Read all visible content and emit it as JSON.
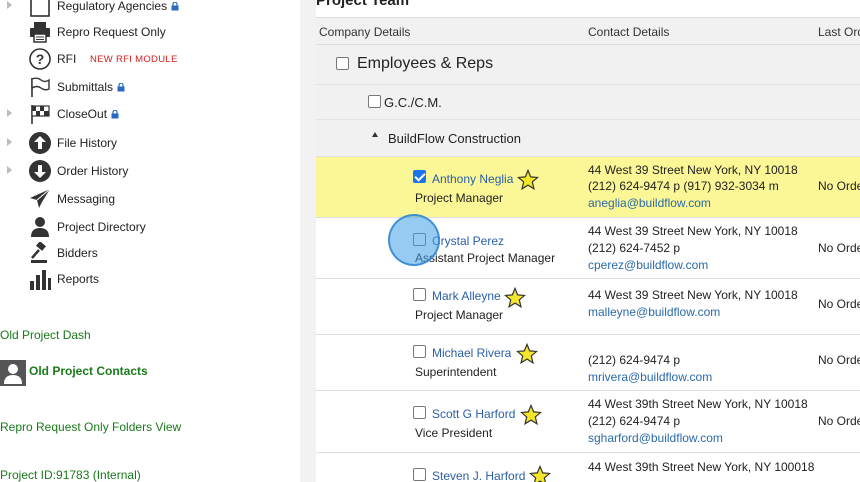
{
  "sidebar": {
    "items": [
      {
        "label": "Regulatory Agencies",
        "locked": true,
        "icon": "blank-doc-icon"
      },
      {
        "label": "Repro Request Only",
        "locked": false,
        "icon": "printer-icon"
      },
      {
        "label": "RFI",
        "locked": false,
        "icon": "question-icon",
        "badge": "NEW RFI MODULE"
      },
      {
        "label": "Submittals",
        "locked": true,
        "icon": "flag-icon"
      },
      {
        "label": "CloseOut",
        "locked": true,
        "icon": "checkered-flag-icon"
      },
      {
        "label": "File History",
        "locked": false,
        "icon": "arrow-up-circle-icon"
      },
      {
        "label": "Order History",
        "locked": false,
        "icon": "arrow-down-circle-icon"
      },
      {
        "label": "Messaging",
        "locked": false,
        "icon": "paper-plane-icon"
      },
      {
        "label": "Project Directory",
        "locked": false,
        "icon": "person-icon"
      },
      {
        "label": "Bidders",
        "locked": false,
        "icon": "gavel-icon"
      },
      {
        "label": "Reports",
        "locked": false,
        "icon": "bar-chart-icon"
      }
    ],
    "old_project_dash": "Old Project Dash",
    "old_project_contacts": "Old Project Contacts",
    "repro_folders_view": "Repro Request Only Folders View",
    "project_id": "Project ID:91783 (Internal)"
  },
  "main": {
    "title": "Project Team",
    "columns": {
      "company": "Company Details",
      "contact": "Contact Details",
      "last_order": "Last Ord"
    },
    "group_employees": "Employees & Reps",
    "group_gc": "G.C./C.M.",
    "company": "BuildFlow Construction",
    "contacts": [
      {
        "name": "Anthony Neglia",
        "role": "Project Manager",
        "starred": true,
        "checked": true,
        "address": "44 West 39 Street New York, NY 10018",
        "phone": "(212) 624-9474 p  (917) 932-3034 m",
        "email": "aneglia@buildflow.com",
        "last_order": "No Orde"
      },
      {
        "name": "Crystal Perez",
        "role": "Assistant Project Manager",
        "starred": false,
        "checked": false,
        "address": "44 West 39 Street New York, NY 10018",
        "phone": "(212) 624-7452 p",
        "email": "cperez@buildflow.com",
        "last_order": "No Orde"
      },
      {
        "name": "Mark Alleyne",
        "role": "Project Manager",
        "starred": true,
        "checked": false,
        "address": "44 West 39 Street New York, NY 10018",
        "phone": "",
        "email": "malleyne@buildflow.com",
        "last_order": "No Orde"
      },
      {
        "name": "Michael Rivera",
        "role": "Superintendent",
        "starred": true,
        "checked": false,
        "address": "",
        "phone": "(212) 624-9474 p",
        "email": "mrivera@buildflow.com",
        "last_order": "No Orde"
      },
      {
        "name": "Scott G Harford",
        "role": "Vice President",
        "starred": true,
        "checked": false,
        "address": "44 West 39th Street New York, NY 10018",
        "phone": "(212) 624-9474 p",
        "email": "sgharford@buildflow.com",
        "last_order": "No Orde"
      },
      {
        "name": "Steven J. Harford",
        "role": "",
        "starred": true,
        "checked": false,
        "address": "44 West 39th Street New York, NY 100018",
        "phone": "",
        "email": "",
        "last_order": ""
      }
    ]
  },
  "colors": {
    "highlight_row": "#fbf696",
    "link_blue": "#2a5fa8",
    "green_link": "#1a7a1a",
    "badge_red": "#d32020",
    "star_yellow": "#f5e62a"
  }
}
